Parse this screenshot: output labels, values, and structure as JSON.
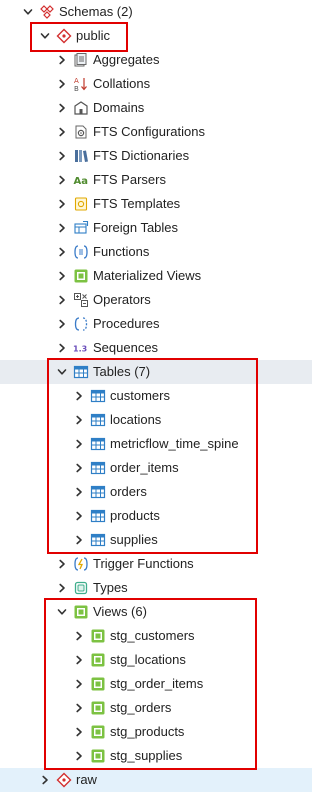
{
  "tree": {
    "schemas": {
      "label": "Schemas (2)",
      "icon": "schemas-icon"
    },
    "public": {
      "label": "public",
      "icon": "schema-icon"
    },
    "public_children": [
      {
        "label": "Aggregates",
        "icon": "aggregates-icon"
      },
      {
        "label": "Collations",
        "icon": "collations-icon"
      },
      {
        "label": "Domains",
        "icon": "domains-icon"
      },
      {
        "label": "FTS Configurations",
        "icon": "fts-configurations-icon"
      },
      {
        "label": "FTS Dictionaries",
        "icon": "fts-dictionaries-icon"
      },
      {
        "label": "FTS Parsers",
        "icon": "fts-parsers-icon",
        "glyph": "Aa"
      },
      {
        "label": "FTS Templates",
        "icon": "fts-templates-icon"
      },
      {
        "label": "Foreign Tables",
        "icon": "foreign-tables-icon"
      },
      {
        "label": "Functions",
        "icon": "functions-icon"
      },
      {
        "label": "Materialized Views",
        "icon": "materialized-views-icon"
      },
      {
        "label": "Operators",
        "icon": "operators-icon"
      },
      {
        "label": "Procedures",
        "icon": "procedures-icon"
      },
      {
        "label": "Sequences",
        "icon": "sequences-icon",
        "glyph": "1.3"
      }
    ],
    "tables": {
      "label": "Tables (7)",
      "icon": "tables-icon",
      "items": [
        "customers",
        "locations",
        "metricflow_time_spine",
        "order_items",
        "orders",
        "products",
        "supplies"
      ]
    },
    "after_tables": [
      {
        "label": "Trigger Functions",
        "icon": "trigger-functions-icon"
      },
      {
        "label": "Types",
        "icon": "types-icon"
      }
    ],
    "views": {
      "label": "Views (6)",
      "icon": "views-icon",
      "items": [
        "stg_customers",
        "stg_locations",
        "stg_order_items",
        "stg_orders",
        "stg_products",
        "stg_supplies"
      ]
    },
    "raw": {
      "label": "raw",
      "icon": "schema-icon"
    }
  },
  "colors": {
    "highlight_box": "#e10000",
    "schema_red": "#d32f2f",
    "table_blue": "#2f7fc6",
    "view_green": "#7cc242",
    "selected_row": "#e3f1fb"
  }
}
